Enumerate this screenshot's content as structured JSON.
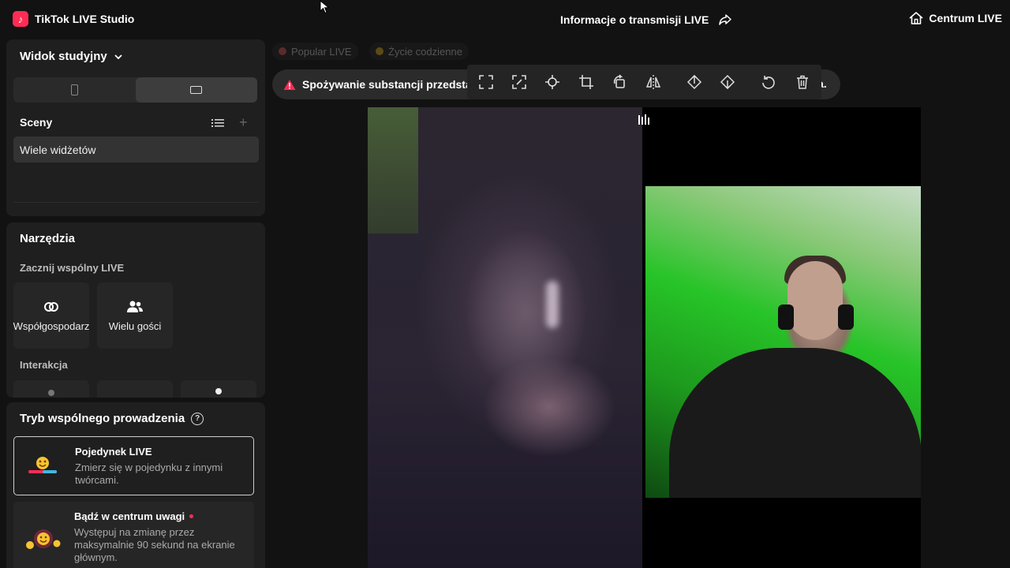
{
  "app": {
    "title": "TikTok LIVE Studio"
  },
  "header": {
    "live_info": "Informacje o transmisji LIVE",
    "live_center": "Centrum LIVE"
  },
  "studio": {
    "view_label": "Widok studyjny",
    "scenes_label": "Sceny",
    "scenes": [
      "Wiele widżetów"
    ]
  },
  "tools": {
    "title": "Narzędzia",
    "group_start": "Zacznij wspólny LIVE",
    "cohost_label": "Współgospodarz",
    "multi_guest_label": "Wielu gości",
    "group_interaction": "Interakcja"
  },
  "cohost_mode": {
    "title": "Tryb wspólnego prowadzenia",
    "modes": [
      {
        "title": "Pojedynek LIVE",
        "description": "Zmierz się w pojedynku z innymi twórcami."
      },
      {
        "title": "Bądź w centrum uwagi",
        "description": "Występuj na zmianę przez maksymalnie 90 sekund na ekranie głównym."
      }
    ]
  },
  "preview": {
    "categories": [
      "Popular LIVE",
      "Życie codzienne"
    ],
    "warning_text": "Spożywanie substancji przedsta",
    "warning_tail": "a."
  },
  "colors": {
    "accent": "#fe2c55",
    "panel": "#1f1f1f",
    "background": "#121212"
  }
}
